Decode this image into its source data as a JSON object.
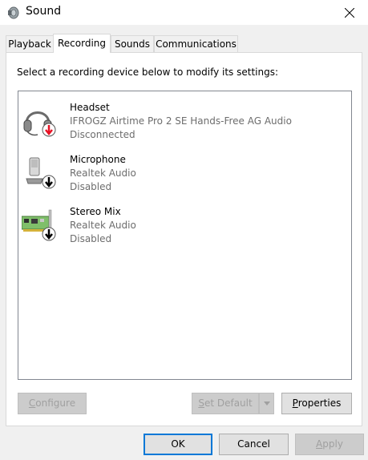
{
  "window": {
    "title": "Sound"
  },
  "tabs": [
    {
      "label": "Playback"
    },
    {
      "label": "Recording"
    },
    {
      "label": "Sounds"
    },
    {
      "label": "Communications"
    }
  ],
  "instructions": "Select a recording device below to modify its settings:",
  "devices": [
    {
      "name": "Headset",
      "description": "IFROGZ Airtime Pro 2 SE Hands-Free AG Audio",
      "status": "Disconnected",
      "icon": "headset-icon"
    },
    {
      "name": "Microphone",
      "description": "Realtek Audio",
      "status": "Disabled",
      "icon": "microphone-icon"
    },
    {
      "name": "Stereo Mix",
      "description": "Realtek Audio",
      "status": "Disabled",
      "icon": "sound-card-icon"
    }
  ],
  "buttons": {
    "configure": "Configure",
    "set_default": "Set Default",
    "properties": "Properties",
    "ok": "OK",
    "cancel": "Cancel",
    "apply": "Apply"
  },
  "colors": {
    "accent": "#0078d7",
    "status_error_arrow": "#e81123",
    "disabled_text": "#a0a0a0"
  }
}
